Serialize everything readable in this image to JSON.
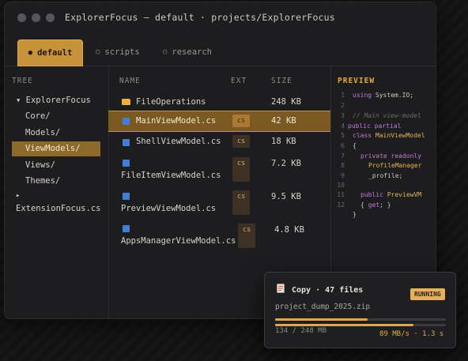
{
  "window": {
    "title": "ExplorerFocus — default · projects/ExplorerFocus"
  },
  "tabs": [
    {
      "label": "default",
      "bullet": "●"
    },
    {
      "label": "scripts",
      "bullet": "○"
    },
    {
      "label": "research",
      "bullet": "○"
    }
  ],
  "tree": {
    "header": "TREE",
    "items": [
      {
        "label": "ExplorerFocus",
        "bullet": "▾"
      },
      {
        "label": "Core/"
      },
      {
        "label": "Models/"
      },
      {
        "label": "ViewModels/"
      },
      {
        "label": "Views/"
      },
      {
        "label": "Themes/"
      },
      {
        "label": "ExtensionFocus.cs",
        "bullet": "▸"
      }
    ]
  },
  "files": {
    "headers": {
      "name": "NAME",
      "ext": "EXT",
      "size": "SIZE"
    },
    "rows": [
      {
        "name": "FileOperations",
        "ext": "",
        "size": "248 KB",
        "icon": "folder-icon"
      },
      {
        "name": "MainViewModel.cs",
        "ext": "cs",
        "size": "42 KB",
        "icon": "csharp-file-icon"
      },
      {
        "name": "ShellViewModel.cs",
        "ext": "cs",
        "size": "18 KB",
        "icon": "csharp-file-icon"
      },
      {
        "name": "FileItemViewModel.cs",
        "ext": "cs",
        "size": "7.2 KB",
        "icon": "csharp-file-icon"
      },
      {
        "name": "PreviewViewModel.cs",
        "ext": "cs",
        "size": "9.5 KB",
        "icon": "csharp-file-icon"
      },
      {
        "name": "AppsManagerViewModel.cs",
        "ext": "cs",
        "size": "4.8 KB",
        "icon": "csharp-file-icon"
      }
    ]
  },
  "preview": {
    "header": "PREVIEW",
    "line_numbers": [
      "1",
      "2",
      "3",
      "4",
      "5",
      "6",
      "7",
      "8",
      "9",
      "10",
      "11",
      "12"
    ]
  },
  "toast": {
    "title": "Copy · 47 files",
    "status": "RUNNING",
    "filename": "project_dump_2025.zip",
    "progress_text": "134 / 248 MB",
    "speed": "89 MB/s · 1.3 s",
    "progress_primary": 0.54,
    "progress_secondary": 0.81,
    "icon": "document-icon"
  },
  "colors": {
    "accent": "#c8923a",
    "background": "#1d1d1f",
    "cs_icon": "#3f7fd8",
    "folder_icon": "#e9b241"
  }
}
